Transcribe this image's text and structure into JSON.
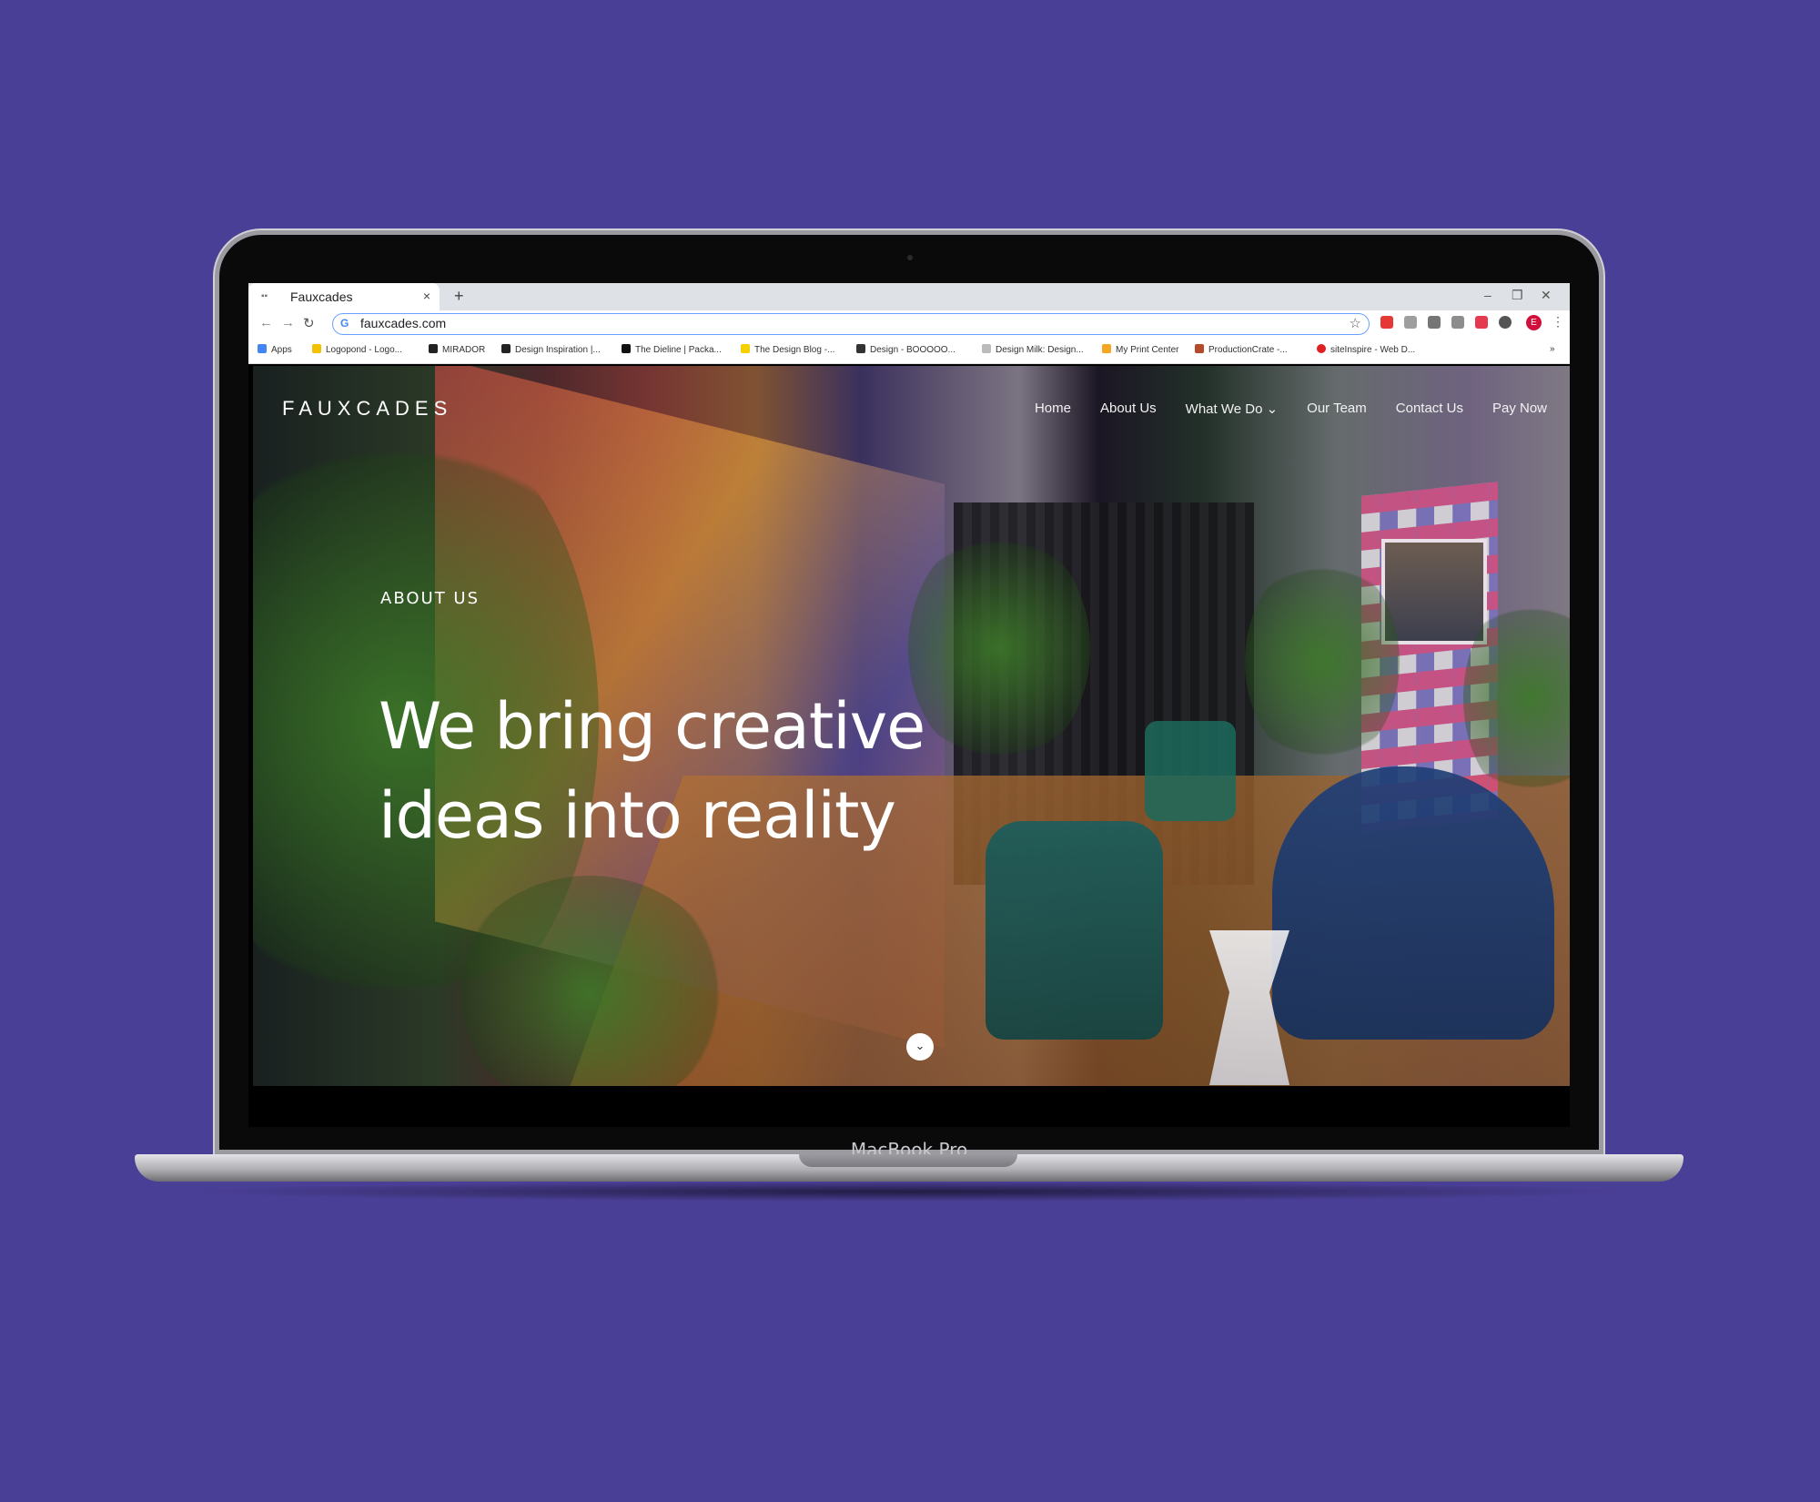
{
  "browser": {
    "tab_title": "Fauxcades",
    "tab_favicon": "fauxcades-favicon",
    "new_tab_label": "+",
    "url": "fauxcades.com",
    "profile_initial": "E",
    "bookmarks": [
      {
        "label": "Apps",
        "color": "#4285f4"
      },
      {
        "label": "Logopond - Logo...",
        "color": "#f2c200"
      },
      {
        "label": "MIRADOR",
        "color": "#222222"
      },
      {
        "label": "Design Inspiration |...",
        "color": "#222222"
      },
      {
        "label": "The Dieline | Packa...",
        "color": "#111111"
      },
      {
        "label": "The Design Blog -...",
        "color": "#f4d000"
      },
      {
        "label": "Design - BOOOOO...",
        "color": "#333333"
      },
      {
        "label": "Design Milk: Design...",
        "color": "#bbbbbb"
      },
      {
        "label": "My Print Center",
        "color": "#f5a623"
      },
      {
        "label": "ProductionCrate -...",
        "color": "#b54b2a"
      },
      {
        "label": "siteInspire - Web D...",
        "color": "#e02020"
      }
    ]
  },
  "site": {
    "logo": "FAUXCADES",
    "nav": [
      "Home",
      "About Us",
      "What We Do",
      "Our Team",
      "Contact Us",
      "Pay Now"
    ],
    "dropdown_glyph": "⌄",
    "eyebrow": "ABOUT US",
    "headline": "We bring creative ideas into reality"
  },
  "device": {
    "label": "MacBook Pro"
  },
  "colors": {
    "background": "#4a3f96",
    "accent_link": "#4285f4"
  }
}
